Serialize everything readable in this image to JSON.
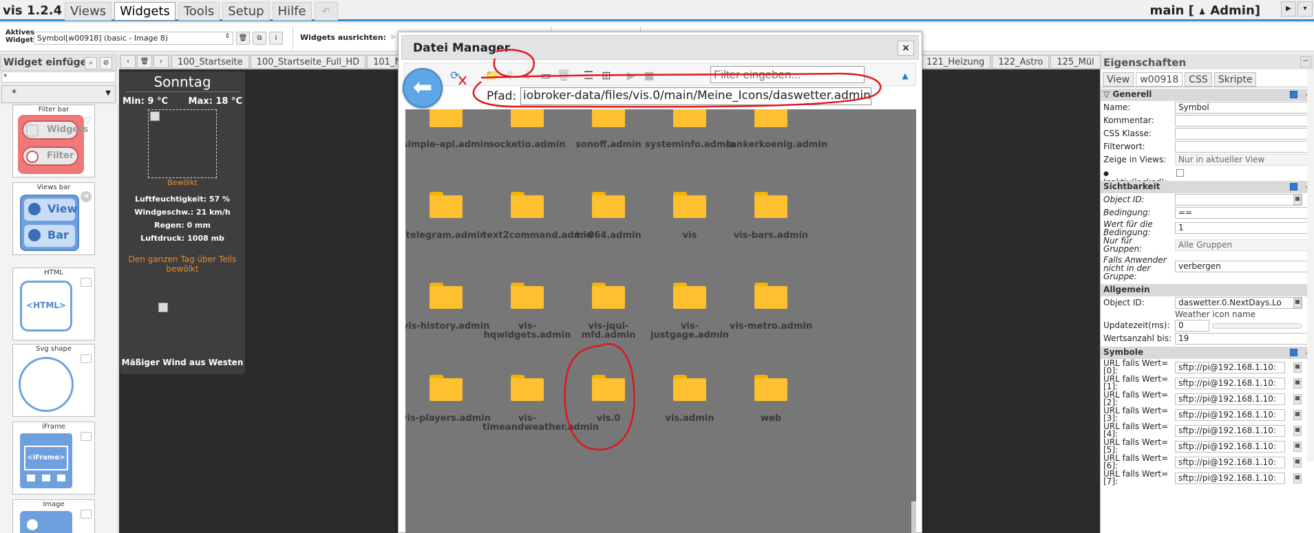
{
  "app": {
    "title": "vis 1.2.4",
    "menu": [
      "Views",
      "Widgets",
      "Tools",
      "Setup",
      "Hilfe"
    ],
    "active_menu": "Widgets",
    "project": "main [",
    "user": "Admin]"
  },
  "toolbar": {
    "active_widget_label": "Aktives\nWidget:",
    "active_widget_value": "Symbol[w00918] (basic - Image 8)",
    "align_label": "Widgets ausrichten:"
  },
  "palette": {
    "title": "Widget einfügen",
    "filter_value": "*",
    "set_value": "*",
    "items": [
      {
        "label": "Filter bar",
        "lines": [
          "Widgets",
          "Filter"
        ]
      },
      {
        "label": "Views bar",
        "lines": [
          "View",
          "Bar"
        ]
      },
      {
        "label": "HTML",
        "lines": [
          "<HTML>"
        ]
      },
      {
        "label": "Svg shape",
        "lines": []
      },
      {
        "label": "iFrame",
        "lines": [
          "<iFrame>"
        ]
      },
      {
        "label": "Image",
        "lines": []
      }
    ]
  },
  "canvas": {
    "tabs": [
      "100_Startseite",
      "100_Startseite_Full_HD",
      "101_N",
      "121_Heizung",
      "122_Astro",
      "125_Mül"
    ]
  },
  "weather": {
    "day": "Sonntag",
    "min": "Min: 9 °C",
    "max": "Max: 18 °C",
    "desc": "Bewölkt",
    "humidity": "Luftfeuchtigkeit: 57 %",
    "wind_speed": "Windgeschw.: 21 km/h",
    "rain": "Regen: 0 mm",
    "pressure": "Luftdruck: 1008 mb",
    "summary": "Den ganzen Tag über Teils bewölkt",
    "wind_dir": "Mäßiger Wind aus Westen"
  },
  "dialog": {
    "title": "Datei Manager",
    "filter_placeholder": "Filter eingeben...",
    "path_label": "Pfad:",
    "path_value": "iobroker-data/files/vis.0/main/Meine_Icons/daswetter.admin",
    "folders": [
      "simple-api.admin",
      "socketio.admin",
      "sonoff.admin",
      "systeminfo.admin",
      "tankerkoenig.admin",
      "telegram.admin",
      "text2command.admin",
      "tr-064.admin",
      "vis",
      "vis-bars.admin",
      "vis-history.admin",
      "vis-hqwidgets.admin",
      "vis-jqui-mfd.admin",
      "vis-justgage.admin",
      "vis-metro.admin",
      "vis-players.admin",
      "vis-timeandweather.admin",
      "vis.0",
      "vis.admin",
      "web"
    ]
  },
  "props": {
    "title": "Eigenschaften",
    "tabs": [
      "View",
      "w00918",
      "CSS",
      "Skripte"
    ],
    "sections": {
      "generell": "Generell",
      "sichtbarkeit": "Sichtbarkeit",
      "allgemein": "Allgemein",
      "symbole": "Symbole"
    },
    "name_label": "Name:",
    "name_value": "Symbol",
    "comment_label": "Kommentar:",
    "css_label": "CSS Klasse:",
    "filter_label": "Filterwort:",
    "views_label": "Zeige in Views:",
    "views_value": "Nur in aktueller View",
    "locked_label": "Inaktiv(locked):",
    "oid_label": "Object ID:",
    "cond_label": "Bedingung:",
    "cond_value": "==",
    "condval_label": "Wert für die Bedingung:",
    "condval_value": "1",
    "groups_label": "Nur für Gruppen:",
    "groups_value": "Alle Gruppen",
    "notin_label": "Falls Anwender nicht in der Gruppe:",
    "notin_value": "verbergen",
    "oid2_label": "Object ID:",
    "oid2_value": "daswetter.0.NextDays.Lo",
    "oid2_hint": "Weather icon name",
    "update_label": "Updatezeit(ms):",
    "update_value": "0",
    "count_label": "Wertsanzahl bis:",
    "count_value": "19",
    "url_rows": [
      {
        "label": "URL falls Wert=",
        "idx": "[0]:",
        "value": "sftp://pi@192.168.1.10:"
      },
      {
        "label": "URL falls Wert=",
        "idx": "[1]:",
        "value": "sftp://pi@192.168.1.10:"
      },
      {
        "label": "URL falls Wert=",
        "idx": "[2]:",
        "value": "sftp://pi@192.168.1.10:"
      },
      {
        "label": "URL falls Wert=",
        "idx": "[3]:",
        "value": "sftp://pi@192.168.1.10:"
      },
      {
        "label": "URL falls Wert=",
        "idx": "[4]:",
        "value": "sftp://pi@192.168.1.10:"
      },
      {
        "label": "URL falls Wert=",
        "idx": "[5]:",
        "value": "sftp://pi@192.168.1.10:"
      },
      {
        "label": "URL falls Wert=",
        "idx": "[6]:",
        "value": "sftp://pi@192.168.1.10:"
      },
      {
        "label": "URL falls Wert=",
        "idx": "[7]:",
        "value": "sftp://pi@192.168.1.10:"
      }
    ]
  },
  "colors": {
    "accent": "#2f8dd3",
    "folder": "#fdc02f",
    "annotation": "#e0161b",
    "weather_orange": "#e88a2a"
  }
}
